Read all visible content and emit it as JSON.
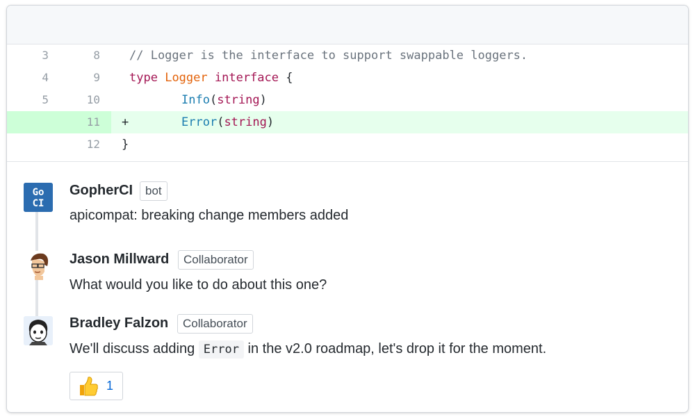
{
  "diff": {
    "lines": [
      {
        "old": "3",
        "new": "8",
        "marker": "",
        "type": "context"
      },
      {
        "old": "4",
        "new": "9",
        "marker": "",
        "type": "context"
      },
      {
        "old": "5",
        "new": "10",
        "marker": "",
        "type": "context"
      },
      {
        "old": "",
        "new": "11",
        "marker": "+",
        "type": "added"
      },
      {
        "old": "",
        "new": "12",
        "marker": "",
        "type": "context"
      }
    ],
    "code": {
      "l1_comment": "// Logger is the interface to support swappable loggers.",
      "l2_kw": "type",
      "l2_type": "Logger",
      "l2_kw2": "interface",
      "l2_brace": "{",
      "l3_fn": "Info",
      "l3_open": "(",
      "l3_arg": "string",
      "l3_close": ")",
      "l4_fn": "Error",
      "l4_open": "(",
      "l4_arg": "string",
      "l4_close": ")",
      "l5_brace": "}"
    }
  },
  "comments": [
    {
      "author": "GopherCI",
      "badge": "bot",
      "avatar_text": "Go CI",
      "body": "apicompat: breaking change members added"
    },
    {
      "author": "Jason Millward",
      "badge": "Collaborator",
      "body": "What would you like to do about this one?"
    },
    {
      "author": "Bradley Falzon",
      "badge": "Collaborator",
      "body_pre": "We'll discuss adding",
      "body_code": "Error",
      "body_post": "in the v2.0 roadmap, let's drop it for the moment."
    }
  ],
  "reaction": {
    "icon": "thumbs-up-icon",
    "count": "1"
  },
  "colors": {
    "added_bg": "#e6ffed",
    "added_gutter": "#cdffd8",
    "keyword": "#a31553",
    "type_name": "#e36209",
    "function_name": "#1b7db0",
    "comment": "#6a737d",
    "link_blue": "#0366d6",
    "gopherci_blue": "#2b6cb0"
  }
}
